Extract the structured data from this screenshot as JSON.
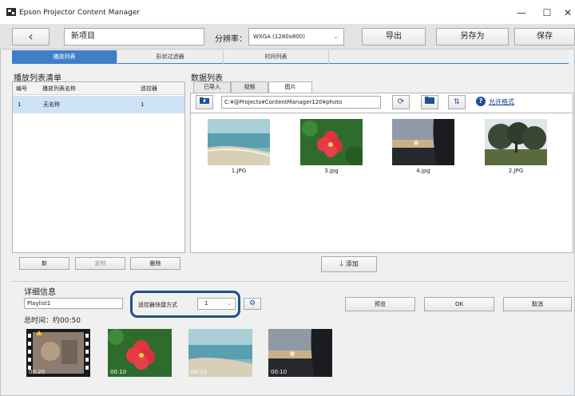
{
  "window": {
    "title": "Epson Projector Content Manager",
    "minimize": "—",
    "maximize": "☐",
    "close": "✕"
  },
  "toolbar": {
    "back": "‹",
    "project_name": "新项目",
    "resolution_label": "分辨率：",
    "resolution_value": "WXGA (1280x800)",
    "export": "导出",
    "save_as": "另存为",
    "save": "保存"
  },
  "tabs": [
    {
      "label": "播放列表"
    },
    {
      "label": "形状过滤器"
    },
    {
      "label": "时间列表"
    }
  ],
  "playlist_panel": {
    "title": "播放列表清单",
    "columns": [
      "编号",
      "播放列表名称",
      "遥控器"
    ],
    "rows": [
      {
        "no": "1",
        "name": "无名称",
        "remote": "1"
      }
    ],
    "buttons": {
      "new": "新",
      "copy": "复制",
      "delete": "删除"
    }
  },
  "data_panel": {
    "title": "数据列表",
    "subtabs": [
      "已导入",
      "视频",
      "图片"
    ],
    "path": "C:¥@Projects¥ContentManager120¥photo",
    "allowed_formats": "允许格式",
    "help": "?",
    "images": [
      {
        "caption": "1.JPG"
      },
      {
        "caption": "3.jpg"
      },
      {
        "caption": "4.jpg"
      },
      {
        "caption": "2.JPG"
      }
    ],
    "add": "添加"
  },
  "details": {
    "title": "详细信息",
    "playlist_name": "Playlist1",
    "remote_label": "遥控器快捷方式",
    "remote_value": "1",
    "preview": "预览",
    "ok": "OK",
    "cancel": "取消",
    "total_time": "总时间：约00:50",
    "thumbs": [
      {
        "duration": "00:20"
      },
      {
        "duration": "00:10"
      },
      {
        "duration": "00:10"
      },
      {
        "duration": "00:10"
      }
    ]
  }
}
